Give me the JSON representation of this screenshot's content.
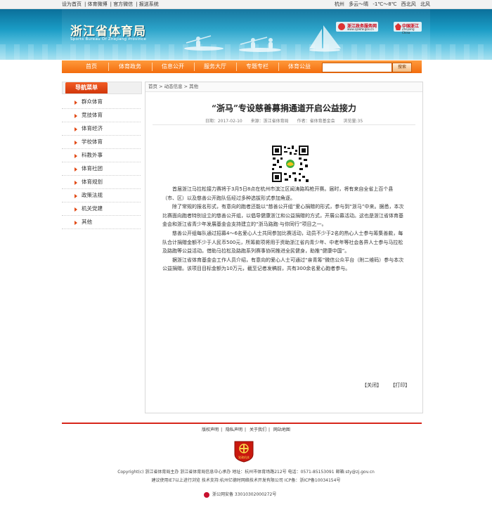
{
  "topbar": {
    "left": [
      "设为首页",
      "体育微博",
      "官方微信",
      "报送系统"
    ],
    "right": [
      "杭州",
      "多云～晴",
      "-1℃～8℃",
      "西北风",
      "北风"
    ]
  },
  "banner": {
    "title": "浙江省体育局",
    "subtitle": "Sports Bureau Of Zhejiang Province",
    "logo1_title": "浙江政务服务网",
    "logo1_url": "www.zjzwfw.gov.cn",
    "logo2_title": "中国浙江",
    "logo2_sub": "Zhejiang China"
  },
  "nav": {
    "items": [
      "首页",
      "体育政务",
      "信息公开",
      "服务大厅",
      "专题专栏",
      "体育公益"
    ],
    "search_placeholder": "",
    "search_button": "搜索"
  },
  "sidebar": {
    "heading": "导航菜单",
    "items": [
      "群众体育",
      "竞技体育",
      "体育经济",
      "学校体育",
      "科教外事",
      "体育社团",
      "体育规划",
      "政策法规",
      "机关党建",
      "其他"
    ]
  },
  "breadcrumb": "首页 > 动态信息 > 其他",
  "article": {
    "title": "“浙马”专设慈善募捐通道开启公益接力",
    "meta": {
      "date": "日期：2017-02-10",
      "source": "来源：浙江省体育局",
      "author": "作者：省体育基金会",
      "views": "浏览量:35"
    },
    "paragraphs": [
      "首届浙江马拉松接力赛将于3月5日8点在杭州市滨江区闻涛路鸣枪开赛。届时，将有来自全省上百个县（市、区）以及慈善公开跑队伍经过多种选拔形式参加角逐。",
      "除了常规的报名形式，有意向的跑者还能以“慈善公开组”爱心捐赠的形式，参与到“浙马”中来。据悉，本次比赛面向跑者特别设立的慈善公开组，以倡导健康浙江和公益捐赠的方式，开展公募活动。这也是浙江省体育基金会和浙江省青少年发展基金会支持建立的“浙马路跑·与你同行”项目之一。",
      "慈善公开组每队通过招募4～6名爱心人士共同参加比赛活动，动员不少于2名的热心人士参与筹集善款，每队合计捐赠金额不少于人民币500元，所筹款项将用于资助浙江省内青少年、中老年等社会各界人士参与马拉松及路跑等公益活动。借助马拉松及路跑系列赛事协同推进全民健身，助推“健康中国”。",
      "据浙江省体育基金会工作人员介绍，有意向的爱心人士可通过“亲青筹”微信公众平台（附二维码）参与本次公益捐赠。该项目目标金额为10万元，截至记者发稿前，共有300余名爱心跑者参与。"
    ],
    "close_label": "【关闭】",
    "print_label": "【打印】"
  },
  "footer": {
    "links": [
      "版权声明",
      "隐私声明",
      "关于我们",
      "网站地图"
    ],
    "emblem_text": "党政机关",
    "line1": "Copyright(c) 浙江省体育局主办  浙江省体育局信息中心承办  地址：杭州市体育场路212号  电话：0571-85153091 邮箱:sty@zj.gov.cn",
    "line2": "建议使用IE7以上进行浏览  技术支持:杭州亿德时网络技术开发有限公司  ICP备：浙ICP备10034154号",
    "line3": "浙公网安备  33010302000272号"
  }
}
